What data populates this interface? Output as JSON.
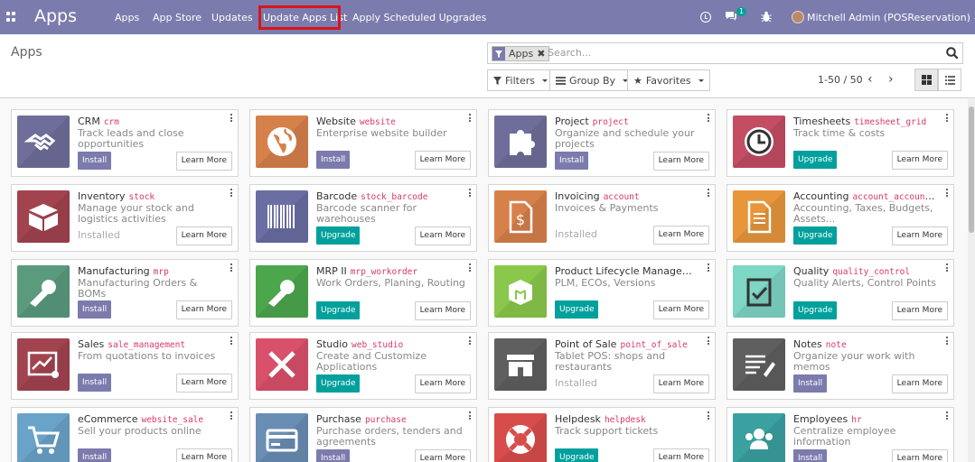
{
  "navbar": {
    "brand": "Apps",
    "menu": [
      "Apps",
      "App Store",
      "Updates",
      "Update Apps List",
      "Apply Scheduled Upgrades"
    ],
    "chat_count": "1",
    "user": "Mitchell Admin (POSReservation)",
    "color": "#7c7bad"
  },
  "control_panel": {
    "title": "Apps",
    "facet": "Apps",
    "search_placeholder": "Search...",
    "filters": "Filters",
    "group_by": "Group By",
    "favorites": "Favorites",
    "pager": "1-50 / 50"
  },
  "colors": {
    "install": "#7c7bad",
    "upgrade": "#00a09d",
    "technical_name": "#d9376e"
  },
  "cards": [
    {
      "name": "CRM",
      "tech": "crm",
      "desc": "Track leads and close opportunities",
      "action": "Install",
      "learn": "Learn More",
      "icon": "handshake-icon",
      "color": "#6f6e9a"
    },
    {
      "name": "Website",
      "tech": "website",
      "desc": "Enterprise website builder",
      "action": "Install",
      "learn": "Learn More",
      "icon": "globe-icon",
      "color": "#d7814a"
    },
    {
      "name": "Project",
      "tech": "project",
      "desc": "Organize and schedule your projects",
      "action": "Install",
      "learn": "Learn More",
      "icon": "puzzle-icon",
      "color": "#6f6e9a"
    },
    {
      "name": "Timesheets",
      "tech": "timesheet_grid",
      "desc": "Track time & costs",
      "action": "Upgrade",
      "learn": "Learn More",
      "icon": "clock-icon",
      "color": "#c44d63"
    },
    {
      "name": "Inventory",
      "tech": "stock",
      "desc": "Manage your stock and logistics activities",
      "action": "Installed",
      "learn": "Learn More",
      "icon": "box-icon",
      "color": "#a24450"
    },
    {
      "name": "Barcode",
      "tech": "stock_barcode",
      "desc": "Barcode scanner for warehouses",
      "action": "Upgrade",
      "learn": "Learn More",
      "icon": "barcode-icon",
      "color": "#6a6ea3"
    },
    {
      "name": "Invoicing",
      "tech": "account",
      "desc": "Invoices & Payments",
      "action": "Installed",
      "learn": "Learn More",
      "icon": "invoice-icon",
      "color": "#d7814a"
    },
    {
      "name": "Accounting",
      "tech": "account_accountant",
      "desc": "Accounting, Taxes, Budgets, Assets...",
      "action": "Upgrade",
      "learn": "Learn More",
      "icon": "document-icon",
      "color": "#e8963c"
    },
    {
      "name": "Manufacturing",
      "tech": "mrp",
      "desc": "Manufacturing Orders & BOMs",
      "action": "Install",
      "learn": "Learn More",
      "icon": "wrench-icon",
      "color": "#5a9b7d"
    },
    {
      "name": "MRP II",
      "tech": "mrp_workorder",
      "desc": "Work Orders, Planing, Routing",
      "action": "Upgrade",
      "learn": "Learn More",
      "icon": "wrench-icon",
      "color": "#4ca64c"
    },
    {
      "name": "Product Lifecycle Management (PLM)",
      "tech": "mrp_plm",
      "desc": "PLM, ECOs, Versions",
      "action": "Upgrade",
      "learn": "Learn More",
      "icon": "cube-icon",
      "color": "#8ac84b"
    },
    {
      "name": "Quality",
      "tech": "quality_control",
      "desc": "Quality Alerts, Control Points",
      "action": "Upgrade",
      "learn": "Learn More",
      "icon": "clipboard-check-icon",
      "color": "#7ed6c5"
    },
    {
      "name": "Sales",
      "tech": "sale_management",
      "desc": "From quotations to invoices",
      "action": "Install",
      "learn": "Learn More",
      "icon": "chart-gear-icon",
      "color": "#a24450"
    },
    {
      "name": "Studio",
      "tech": "web_studio",
      "desc": "Create and Customize Applications",
      "action": "Upgrade",
      "learn": "Learn More",
      "icon": "tools-icon",
      "color": "#d9506a"
    },
    {
      "name": "Point of Sale",
      "tech": "point_of_sale",
      "desc": "Tablet POS: shops and restaurants",
      "action": "Installed",
      "learn": "Learn More",
      "icon": "shop-icon",
      "color": "#5f5f5f"
    },
    {
      "name": "Notes",
      "tech": "note",
      "desc": "Organize your work with memos",
      "action": "Install",
      "learn": "Learn More",
      "icon": "pencil-note-icon",
      "color": "#5f5f5f"
    },
    {
      "name": "eCommerce",
      "tech": "website_sale",
      "desc": "Sell your products online",
      "action": "Install",
      "learn": "Learn More",
      "icon": "cart-icon",
      "color": "#6aa3c8"
    },
    {
      "name": "Purchase",
      "tech": "purchase",
      "desc": "Purchase orders, tenders and agreements",
      "action": "Install",
      "learn": "Learn More",
      "icon": "credit-card-icon",
      "color": "#6a8db3"
    },
    {
      "name": "Helpdesk",
      "tech": "helpdesk",
      "desc": "Track support tickets",
      "action": "Upgrade",
      "learn": "Learn More",
      "icon": "lifebuoy-icon",
      "color": "#d94c4c"
    },
    {
      "name": "Employees",
      "tech": "hr",
      "desc": "Centralize employee information",
      "action": "Install",
      "learn": "Learn More",
      "icon": "users-icon",
      "color": "#3aa0a0"
    }
  ]
}
